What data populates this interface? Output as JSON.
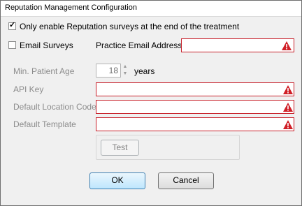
{
  "window": {
    "title": "Reputation Management Configuration"
  },
  "options": {
    "only_end_of_treatment": {
      "label": "Only enable Reputation surveys at the end of the treatment",
      "checked": true
    },
    "email_surveys": {
      "label": "Email Surveys",
      "checked": false
    }
  },
  "fields": {
    "practice_email": {
      "label": "Practice Email Address",
      "value": ""
    },
    "min_patient_age": {
      "label": "Min. Patient Age",
      "value": "18",
      "unit": "years"
    },
    "api_key": {
      "label": "API Key",
      "value": ""
    },
    "default_location_code": {
      "label": "Default Location Code",
      "value": ""
    },
    "default_template": {
      "label": "Default Template",
      "value": ""
    }
  },
  "buttons": {
    "test": "Test",
    "ok": "OK",
    "cancel": "Cancel"
  },
  "colors": {
    "error_border": "#c8202a",
    "warning_icon": "#d01f27"
  },
  "icons": {
    "warning": "warning-icon",
    "check": "check-icon"
  }
}
